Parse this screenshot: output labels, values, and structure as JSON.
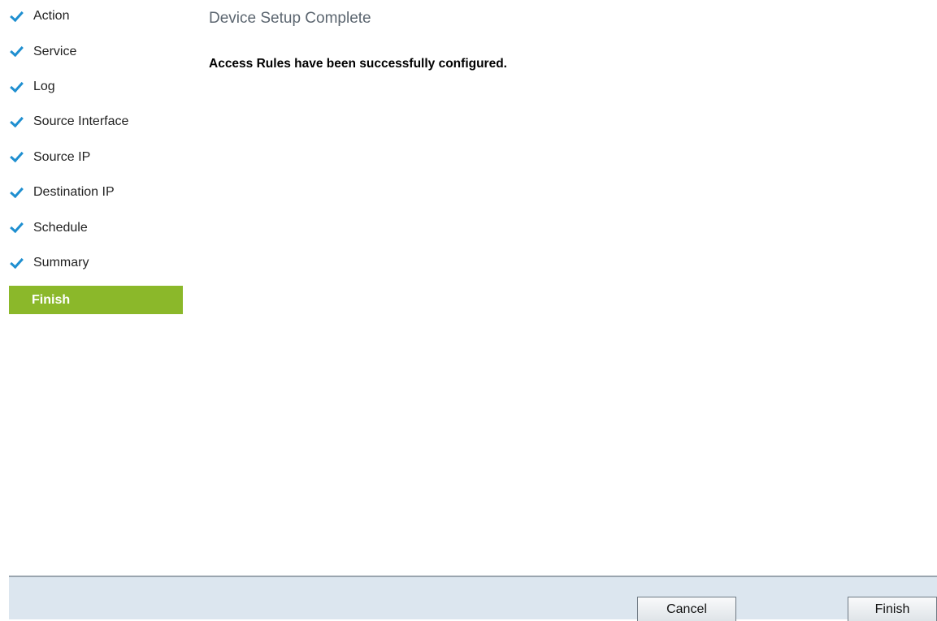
{
  "wizard": {
    "steps": [
      {
        "label": "Action",
        "status": "complete"
      },
      {
        "label": "Service",
        "status": "complete"
      },
      {
        "label": "Log",
        "status": "complete"
      },
      {
        "label": "Source Interface",
        "status": "complete"
      },
      {
        "label": "Source IP",
        "status": "complete"
      },
      {
        "label": "Destination IP",
        "status": "complete"
      },
      {
        "label": "Schedule",
        "status": "complete"
      },
      {
        "label": "Summary",
        "status": "complete"
      },
      {
        "label": "Finish",
        "status": "current"
      }
    ],
    "check_icon": "check-icon",
    "check_color": "#1f8fd0",
    "current_step_color": "#8bb82a"
  },
  "main": {
    "title": "Device Setup Complete",
    "message": "Access Rules have been successfully configured."
  },
  "footer": {
    "cancel_label": "Cancel",
    "finish_label": "Finish"
  }
}
